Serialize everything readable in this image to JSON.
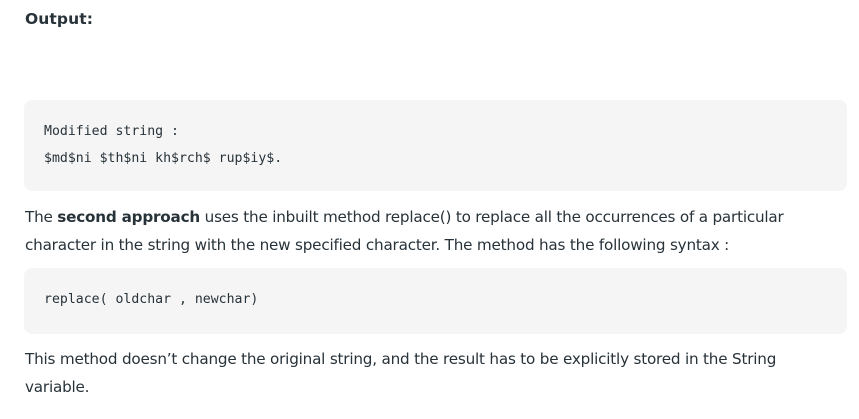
{
  "heading": "Output:",
  "output_block": {
    "line1": "Modified string :",
    "line2": "$md$ni $th$ni kh$rch$ rup$iy$."
  },
  "para1": {
    "before": "The ",
    "bold": "second approach",
    "after_line1": " uses the inbuilt method replace() to replace all the occurrences of a particular",
    "line2": "character in the string with the new specified character. The method has the following syntax :"
  },
  "syntax_block": {
    "line1": "replace( oldchar , newchar)"
  },
  "para2": {
    "line1": "This method doesn’t change the original string, and the result has to be explicitly stored in the String",
    "line2": "variable."
  }
}
